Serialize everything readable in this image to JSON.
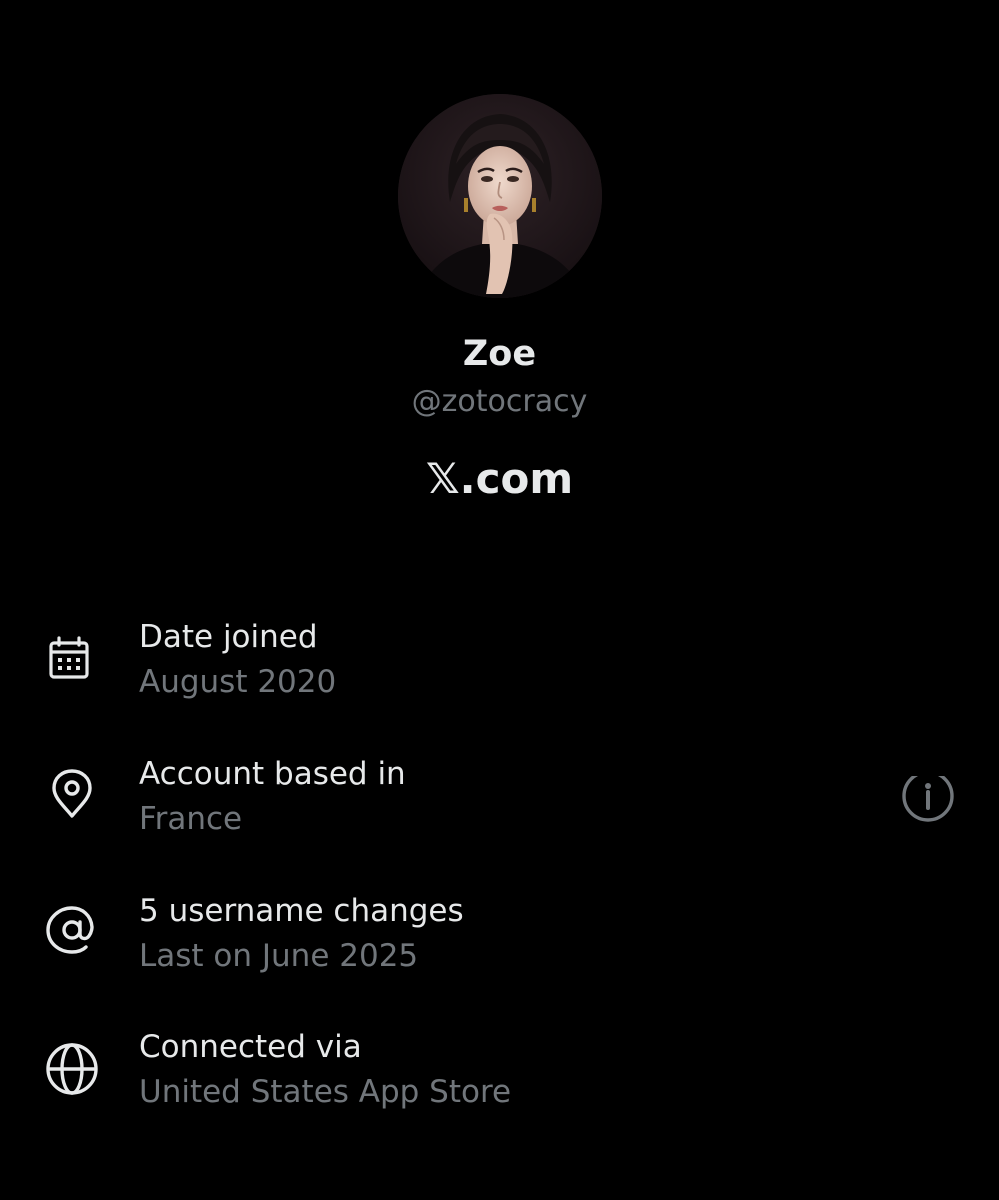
{
  "profile": {
    "display_name": "Zoe",
    "handle": "@zotocracy",
    "brand": "𝕏.com"
  },
  "details": [
    {
      "icon": "calendar-icon",
      "title": "Date joined",
      "value": "August 2020"
    },
    {
      "icon": "location-pin-icon",
      "title": "Account based in",
      "value": "France",
      "action_icon": "info-icon"
    },
    {
      "icon": "at-sign-icon",
      "title": "5 username changes",
      "value": "Last on June 2025"
    },
    {
      "icon": "globe-icon",
      "title": "Connected via",
      "value": "United States App Store"
    }
  ],
  "colors": {
    "background": "#000000",
    "primary_text": "#e7e9ea",
    "secondary_text": "#71767b"
  }
}
